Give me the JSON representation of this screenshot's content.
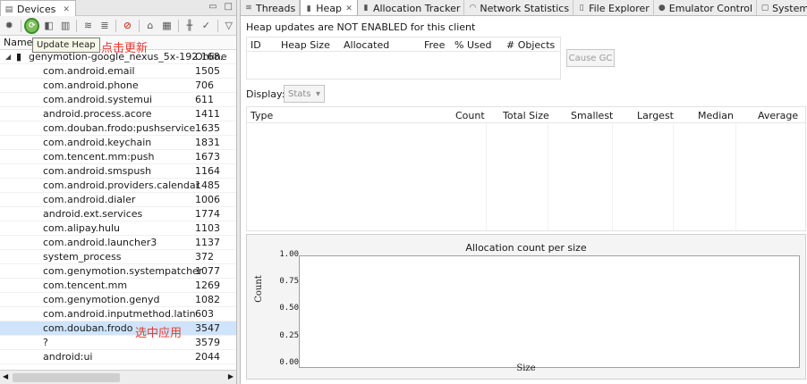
{
  "devices_panel": {
    "tab_label": "Devices",
    "col_name": "Name",
    "tooltip": "Update Heap",
    "annotation_update": "点击更新",
    "annotation_select": "选中应用",
    "device": {
      "name": "genymotion-google_nexus_5x-192.168.",
      "status": "Online"
    },
    "processes": [
      {
        "name": "com.android.email",
        "pid": "1505"
      },
      {
        "name": "com.android.phone",
        "pid": "706"
      },
      {
        "name": "com.android.systemui",
        "pid": "611"
      },
      {
        "name": "android.process.acore",
        "pid": "1411"
      },
      {
        "name": "com.douban.frodo:pushservice",
        "pid": "1635"
      },
      {
        "name": "com.android.keychain",
        "pid": "1831"
      },
      {
        "name": "com.tencent.mm:push",
        "pid": "1673"
      },
      {
        "name": "com.android.smspush",
        "pid": "1164"
      },
      {
        "name": "com.android.providers.calendar",
        "pid": "1485"
      },
      {
        "name": "com.android.dialer",
        "pid": "1006"
      },
      {
        "name": "android.ext.services",
        "pid": "1774"
      },
      {
        "name": "com.alipay.hulu",
        "pid": "1103"
      },
      {
        "name": "com.android.launcher3",
        "pid": "1137"
      },
      {
        "name": "system_process",
        "pid": "372"
      },
      {
        "name": "com.genymotion.systempatcher",
        "pid": "1077"
      },
      {
        "name": "com.tencent.mm",
        "pid": "1269"
      },
      {
        "name": "com.genymotion.genyd",
        "pid": "1082"
      },
      {
        "name": "com.android.inputmethod.latin",
        "pid": "603"
      },
      {
        "name": "com.douban.frodo",
        "pid": "3547"
      },
      {
        "name": "?",
        "pid": "3579"
      },
      {
        "name": "android:ui",
        "pid": "2044"
      }
    ],
    "selected_index": 18
  },
  "tabs": [
    "Threads",
    "Heap",
    "Allocation Tracker",
    "Network Statistics",
    "File Explorer",
    "Emulator Control",
    "System Information"
  ],
  "heap": {
    "message": "Heap updates are NOT ENABLED for this client",
    "columns": [
      "ID",
      "Heap Size",
      "Allocated",
      "Free",
      "% Used",
      "# Objects"
    ],
    "cause_gc": "Cause GC",
    "display_label": "Display:",
    "display_value": "Stats",
    "type_columns": [
      "Type",
      "Count",
      "Total Size",
      "Smallest",
      "Largest",
      "Median",
      "Average"
    ]
  },
  "chart_data": {
    "type": "scatter",
    "title": "Allocation count per size",
    "xlabel": "Size",
    "ylabel": "Count",
    "ylim": [
      0,
      1
    ],
    "yticks": [
      "1.00",
      "0.75",
      "0.50",
      "0.25",
      "0.00"
    ],
    "series": []
  }
}
